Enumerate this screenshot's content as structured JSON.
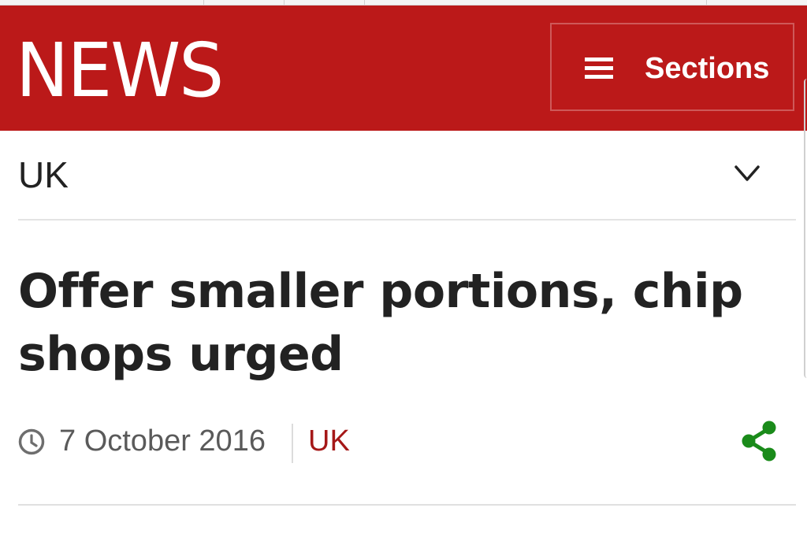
{
  "header": {
    "logo_text": "NEWS",
    "sections_label": "Sections",
    "brand_color": "#bb1919"
  },
  "section_bar": {
    "name": "UK",
    "expand_icon": "chevron-down-icon"
  },
  "article": {
    "headline": "Offer smaller portions, chip shops urged",
    "date": "7 October 2016",
    "section_link": "UK",
    "section_link_color": "#a51818",
    "share_icon": "share-icon",
    "share_color": "#1a8b1a",
    "clock_icon": "clock-icon"
  }
}
